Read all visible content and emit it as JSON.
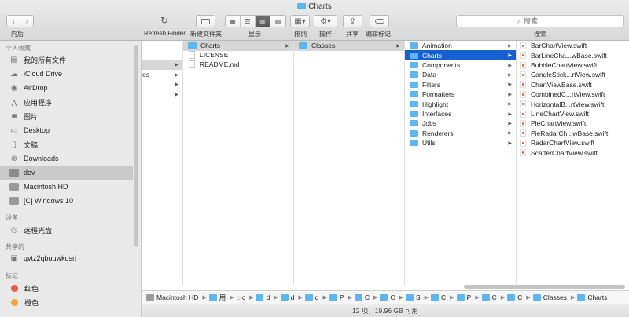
{
  "window": {
    "title": "Charts"
  },
  "toolbar": {
    "back_label": "向后",
    "refresh_label": "Refresh Finder",
    "newfolder_label": "新建文件夹",
    "view_label": "显示",
    "arrange_label": "排列",
    "action_label": "操作",
    "share_label": "共享",
    "tag_label": "编辑标记",
    "search_label": "搜索",
    "search_placeholder": "搜索"
  },
  "sidebar": {
    "favorites_header": "个人收藏",
    "favorites": [
      {
        "label": "我的所有文件",
        "icon": "all-files-icon"
      },
      {
        "label": "iCloud Drive",
        "icon": "cloud-icon"
      },
      {
        "label": "AirDrop",
        "icon": "airdrop-icon"
      },
      {
        "label": "应用程序",
        "icon": "applications-icon"
      },
      {
        "label": "图片",
        "icon": "pictures-icon"
      },
      {
        "label": "Desktop",
        "icon": "desktop-icon"
      },
      {
        "label": "文稿",
        "icon": "documents-icon"
      },
      {
        "label": "Downloads",
        "icon": "downloads-icon"
      },
      {
        "label": "dev",
        "icon": "folder-icon"
      },
      {
        "label": "Macintosh HD",
        "icon": "hard-disk-icon"
      },
      {
        "label": "[C] Windows 10",
        "icon": "hard-disk-icon"
      }
    ],
    "devices_header": "设备",
    "devices": [
      {
        "label": "远程光盘",
        "icon": "optical-disc-icon"
      }
    ],
    "shared_header": "共享的",
    "shared": [
      {
        "label": "qvtz2qbuuwkosrj",
        "icon": "computer-icon"
      }
    ],
    "tags_header": "标记",
    "tags": [
      {
        "label": "红色",
        "color": "#f0574f"
      },
      {
        "label": "橙色",
        "color": "#f7a336"
      }
    ]
  },
  "columns": {
    "col1": {
      "partial_label": "es"
    },
    "col2": [
      "Charts",
      "LICENSE",
      "README.md"
    ],
    "col3": [
      "Classes"
    ],
    "col4": [
      "Animation",
      "Charts",
      "Components",
      "Data",
      "Filters",
      "Formatters",
      "Highlight",
      "Interfaces",
      "Jobs",
      "Renderers",
      "Utils"
    ],
    "col5": [
      "BarChartView.swift",
      "BarLineCha...wBase.swift",
      "BubbleChartView.swift",
      "CandleStick...rtView.swift",
      "ChartViewBase.swift",
      "CombinedC...rtView.swift",
      "HorizontalB...rtView.swift",
      "LineChartView.swift",
      "PieChartView.swift",
      "PieRadarCh...wBase.swift",
      "RadarChartView.swift",
      "ScatterChartView.swift"
    ]
  },
  "pathbar": {
    "segments": [
      "Macintosh HD",
      "用",
      "c",
      "d",
      "d",
      "d",
      "P",
      "C",
      "C",
      "S",
      "C",
      "P",
      "C",
      "C",
      "Classes",
      "Charts"
    ]
  },
  "status": {
    "text": "12 项，19.96 GB 可用"
  }
}
